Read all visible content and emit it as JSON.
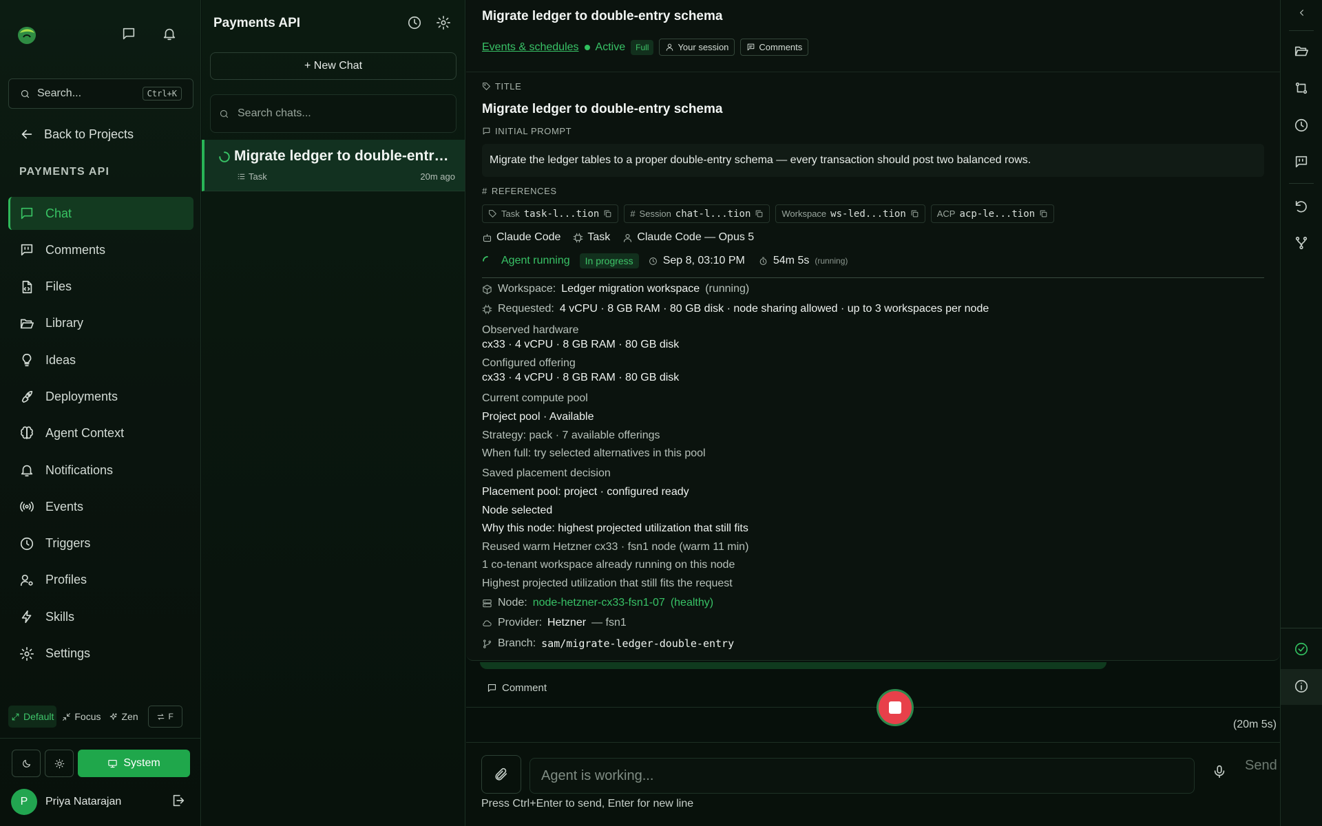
{
  "sidebar": {
    "search_placeholder": "Search...",
    "search_shortcut": "Ctrl+K",
    "back_label": "Back to Projects",
    "project_label": "PAYMENTS API",
    "items": [
      {
        "label": "Chat",
        "icon": "chat-icon"
      },
      {
        "label": "Comments",
        "icon": "comments-icon"
      },
      {
        "label": "Files",
        "icon": "file-icon"
      },
      {
        "label": "Library",
        "icon": "folder-open-icon"
      },
      {
        "label": "Ideas",
        "icon": "lightbulb-icon"
      },
      {
        "label": "Deployments",
        "icon": "rocket-icon"
      },
      {
        "label": "Agent Context",
        "icon": "brain-icon"
      },
      {
        "label": "Notifications",
        "icon": "bell-icon"
      },
      {
        "label": "Events",
        "icon": "broadcast-icon"
      },
      {
        "label": "Triggers",
        "icon": "clock-icon"
      },
      {
        "label": "Profiles",
        "icon": "user-cog-icon"
      },
      {
        "label": "Skills",
        "icon": "bolt-icon"
      },
      {
        "label": "Settings",
        "icon": "gear-icon"
      }
    ],
    "modes": {
      "default": "Default",
      "focus": "Focus",
      "zen": "Zen",
      "toggle": "F"
    },
    "theme": {
      "system_label": "System"
    },
    "user": {
      "initial": "P",
      "name": "Priya Natarajan"
    },
    "accent": "#22a550"
  },
  "chats": {
    "title": "Payments API",
    "new_chat": "+ New Chat",
    "search_placeholder": "Search chats...",
    "items": [
      {
        "name": "Migrate ledger to double-entry schema",
        "kind": "Task",
        "ago": "20m ago"
      }
    ]
  },
  "main": {
    "title": "Migrate ledger to double-entry schema",
    "chips": {
      "link": "Events & schedules",
      "status": "Active",
      "mode": "Full",
      "session": "Your session",
      "comments": "Comments"
    },
    "sections": {
      "title": "TITLE",
      "initial_prompt": "INITIAL PROMPT",
      "references": "REFERENCES"
    },
    "task_title": "Migrate ledger to double-entry schema",
    "prompt": "Migrate the ledger tables to a proper double-entry schema — every transaction should post two balanced rows.",
    "references": [
      {
        "type": "Task",
        "value": "task-l...tion"
      },
      {
        "type": "Session",
        "value": "chat-l...tion"
      },
      {
        "type": "Workspace",
        "value": "ws-led...tion"
      },
      {
        "type": "ACP",
        "value": "acp-le...tion"
      }
    ],
    "meta": {
      "agent": "Claude Code",
      "kind": "Task",
      "model": "Claude Code — Opus 5"
    },
    "status": {
      "running": "Agent running",
      "badge": "In progress",
      "started": "Sep 8, 03:10 PM",
      "duration": "54m 5s",
      "duration_note": "(running)"
    },
    "workspace": {
      "label": "Workspace:",
      "name": "Ledger migration workspace",
      "state": "(running)",
      "requested_label": "Requested:",
      "requested": "4 vCPU · 8 GB RAM · 80 GB disk · node sharing allowed · up to 3 workspaces per node",
      "observed_label": "Observed hardware",
      "observed": "cx33 · 4 vCPU · 8 GB RAM · 80 GB disk",
      "configured_label": "Configured offering",
      "configured": "cx33 · 4 vCPU · 8 GB RAM · 80 GB disk",
      "pool_label": "Current compute pool",
      "pool": "Project pool · Available",
      "strategy": "Strategy: pack · 7 available offerings",
      "when_full": "When full: try selected alternatives in this pool",
      "saved_label": "Saved placement decision",
      "placement": "Placement pool: project · configured ready",
      "node_selected": "Node selected",
      "why": "Why this node: highest projected utilization that still fits",
      "reused": "Reused warm Hetzner cx33 · fsn1 node (warm 11 min)",
      "cotenant": "1 co-tenant workspace already running on this node",
      "highest": "Highest projected utilization that still fits the request",
      "node_label": "Node:",
      "node": "node-hetzner-cx33-fsn1-07",
      "node_health": "(healthy)",
      "provider_label": "Provider:",
      "provider": "Hetzner",
      "region": "— fsn1",
      "branch_label": "Branch:",
      "branch": "sam/migrate-ledger-double-entry"
    },
    "comment_label": "Comment",
    "elapsed": "(20m 5s)",
    "composer": {
      "placeholder": "Agent is working...",
      "send": "Send",
      "hint": "Press Ctrl+Enter to send, Enter for new line"
    }
  },
  "colors": {
    "accent": "#38c266",
    "stop": "#e8404a"
  }
}
